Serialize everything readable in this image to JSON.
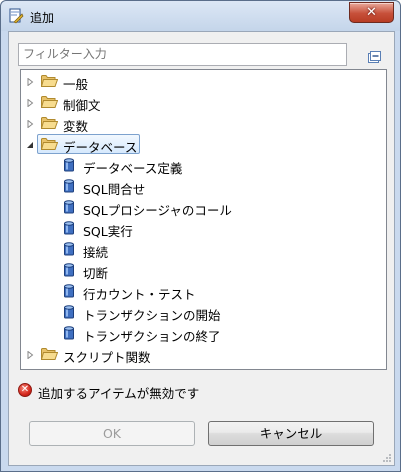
{
  "window": {
    "title": "追加",
    "close_label": "✕"
  },
  "filter": {
    "placeholder": "フィルター入力"
  },
  "tree": {
    "items": [
      {
        "label": "一般",
        "type": "folder",
        "level": 0,
        "expanded": false
      },
      {
        "label": "制御文",
        "type": "folder",
        "level": 0,
        "expanded": false
      },
      {
        "label": "変数",
        "type": "folder",
        "level": 0,
        "expanded": false
      },
      {
        "label": "データベース",
        "type": "folder",
        "level": 0,
        "expanded": true,
        "selected": true
      },
      {
        "label": "データベース定義",
        "type": "db",
        "level": 1
      },
      {
        "label": "SQL問合せ",
        "type": "db",
        "level": 1
      },
      {
        "label": "SQLプロシージャのコール",
        "type": "db",
        "level": 1
      },
      {
        "label": "SQL実行",
        "type": "db",
        "level": 1
      },
      {
        "label": "接続",
        "type": "db",
        "level": 1
      },
      {
        "label": "切断",
        "type": "db",
        "level": 1
      },
      {
        "label": "行カウント・テスト",
        "type": "db",
        "level": 1
      },
      {
        "label": "トランザクションの開始",
        "type": "db",
        "level": 1
      },
      {
        "label": "トランザクションの終了",
        "type": "db",
        "level": 1
      },
      {
        "label": "スクリプト関数",
        "type": "folder",
        "level": 0,
        "expanded": false
      }
    ]
  },
  "status": {
    "message": "追加するアイテムが無効です",
    "icon": "error-icon"
  },
  "buttons": {
    "ok_label": "OK",
    "cancel_label": "キャンセル"
  }
}
